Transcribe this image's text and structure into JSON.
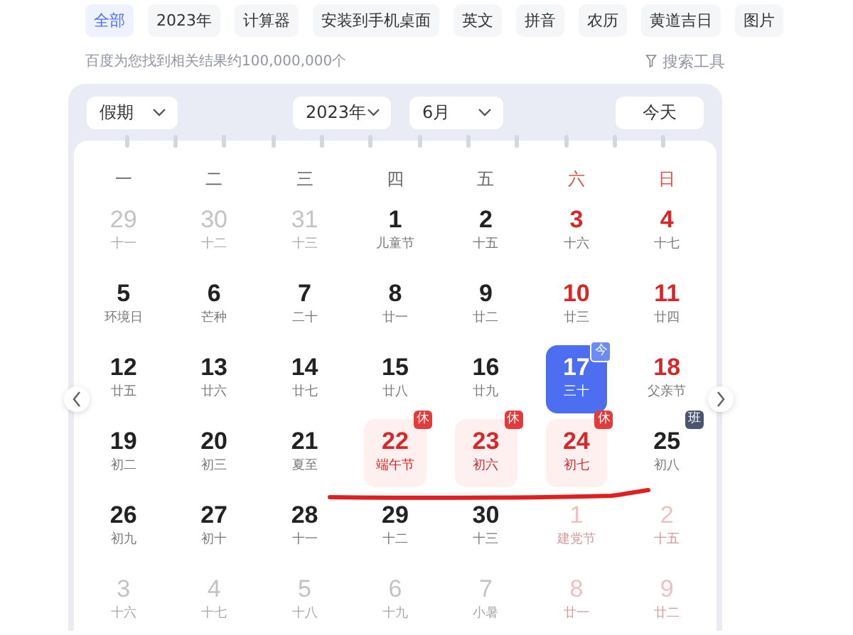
{
  "tabs": [
    {
      "label": "全部",
      "selected": true
    },
    {
      "label": "2023年",
      "selected": false
    },
    {
      "label": "计算器",
      "selected": false
    },
    {
      "label": "安装到手机桌面",
      "selected": false
    },
    {
      "label": "英文",
      "selected": false
    },
    {
      "label": "拼音",
      "selected": false
    },
    {
      "label": "农历",
      "selected": false
    },
    {
      "label": "黄道吉日",
      "selected": false
    },
    {
      "label": "图片",
      "selected": false
    }
  ],
  "result_count": "百度为您找到相关结果约100,000,000个",
  "search_tools": "搜索工具",
  "calendar": {
    "holiday_select": "假期",
    "year_select": "2023年",
    "month_select": "6月",
    "today_button": "今天",
    "weekdays": [
      {
        "label": "一",
        "weekend": false
      },
      {
        "label": "二",
        "weekend": false
      },
      {
        "label": "三",
        "weekend": false
      },
      {
        "label": "四",
        "weekend": false
      },
      {
        "label": "五",
        "weekend": false
      },
      {
        "label": "六",
        "weekend": true
      },
      {
        "label": "日",
        "weekend": true
      }
    ],
    "days": [
      {
        "day": "29",
        "lunar": "十一",
        "in_month": false,
        "weekend": false,
        "holiday": false,
        "selected": false
      },
      {
        "day": "30",
        "lunar": "十二",
        "in_month": false,
        "weekend": false,
        "holiday": false,
        "selected": false
      },
      {
        "day": "31",
        "lunar": "十三",
        "in_month": false,
        "weekend": false,
        "holiday": false,
        "selected": false
      },
      {
        "day": "1",
        "lunar": "儿童节",
        "in_month": true,
        "weekend": false,
        "holiday": false,
        "selected": false
      },
      {
        "day": "2",
        "lunar": "十五",
        "in_month": true,
        "weekend": false,
        "holiday": false,
        "selected": false
      },
      {
        "day": "3",
        "lunar": "十六",
        "in_month": true,
        "weekend": true,
        "holiday": false,
        "selected": false
      },
      {
        "day": "4",
        "lunar": "十七",
        "in_month": true,
        "weekend": true,
        "holiday": false,
        "selected": false
      },
      {
        "day": "5",
        "lunar": "环境日",
        "in_month": true,
        "weekend": false,
        "holiday": false,
        "selected": false
      },
      {
        "day": "6",
        "lunar": "芒种",
        "in_month": true,
        "weekend": false,
        "holiday": false,
        "selected": false
      },
      {
        "day": "7",
        "lunar": "二十",
        "in_month": true,
        "weekend": false,
        "holiday": false,
        "selected": false
      },
      {
        "day": "8",
        "lunar": "廿一",
        "in_month": true,
        "weekend": false,
        "holiday": false,
        "selected": false
      },
      {
        "day": "9",
        "lunar": "廿二",
        "in_month": true,
        "weekend": false,
        "holiday": false,
        "selected": false
      },
      {
        "day": "10",
        "lunar": "廿三",
        "in_month": true,
        "weekend": true,
        "holiday": false,
        "selected": false
      },
      {
        "day": "11",
        "lunar": "廿四",
        "in_month": true,
        "weekend": true,
        "holiday": false,
        "selected": false
      },
      {
        "day": "12",
        "lunar": "廿五",
        "in_month": true,
        "weekend": false,
        "holiday": false,
        "selected": false
      },
      {
        "day": "13",
        "lunar": "廿六",
        "in_month": true,
        "weekend": false,
        "holiday": false,
        "selected": false
      },
      {
        "day": "14",
        "lunar": "廿七",
        "in_month": true,
        "weekend": false,
        "holiday": false,
        "selected": false
      },
      {
        "day": "15",
        "lunar": "廿八",
        "in_month": true,
        "weekend": false,
        "holiday": false,
        "selected": false
      },
      {
        "day": "16",
        "lunar": "廿九",
        "in_month": true,
        "weekend": false,
        "holiday": false,
        "selected": false
      },
      {
        "day": "17",
        "lunar": "三十",
        "in_month": true,
        "weekend": true,
        "holiday": false,
        "selected": true,
        "badge": {
          "kind": "today",
          "text": "今"
        }
      },
      {
        "day": "18",
        "lunar": "父亲节",
        "in_month": true,
        "weekend": true,
        "holiday": false,
        "selected": false
      },
      {
        "day": "19",
        "lunar": "初二",
        "in_month": true,
        "weekend": false,
        "holiday": false,
        "selected": false
      },
      {
        "day": "20",
        "lunar": "初三",
        "in_month": true,
        "weekend": false,
        "holiday": false,
        "selected": false
      },
      {
        "day": "21",
        "lunar": "夏至",
        "in_month": true,
        "weekend": false,
        "holiday": false,
        "selected": false
      },
      {
        "day": "22",
        "lunar": "端午节",
        "in_month": true,
        "weekend": false,
        "holiday": true,
        "selected": false,
        "badge": {
          "kind": "rest",
          "text": "休"
        }
      },
      {
        "day": "23",
        "lunar": "初六",
        "in_month": true,
        "weekend": false,
        "holiday": true,
        "selected": false,
        "badge": {
          "kind": "rest",
          "text": "休"
        }
      },
      {
        "day": "24",
        "lunar": "初七",
        "in_month": true,
        "weekend": true,
        "holiday": true,
        "selected": false,
        "badge": {
          "kind": "rest",
          "text": "休"
        }
      },
      {
        "day": "25",
        "lunar": "初八",
        "in_month": true,
        "weekend": false,
        "holiday": false,
        "selected": false,
        "badge": {
          "kind": "work",
          "text": "班"
        }
      },
      {
        "day": "26",
        "lunar": "初九",
        "in_month": true,
        "weekend": false,
        "holiday": false,
        "selected": false
      },
      {
        "day": "27",
        "lunar": "初十",
        "in_month": true,
        "weekend": false,
        "holiday": false,
        "selected": false
      },
      {
        "day": "28",
        "lunar": "十一",
        "in_month": true,
        "weekend": false,
        "holiday": false,
        "selected": false
      },
      {
        "day": "29",
        "lunar": "十二",
        "in_month": true,
        "weekend": false,
        "holiday": false,
        "selected": false
      },
      {
        "day": "30",
        "lunar": "十三",
        "in_month": true,
        "weekend": false,
        "holiday": false,
        "selected": false
      },
      {
        "day": "1",
        "lunar": "建党节",
        "in_month": false,
        "weekend": true,
        "holiday": false,
        "selected": false
      },
      {
        "day": "2",
        "lunar": "十五",
        "in_month": false,
        "weekend": true,
        "holiday": false,
        "selected": false
      },
      {
        "day": "3",
        "lunar": "十六",
        "in_month": false,
        "weekend": false,
        "holiday": false,
        "selected": false
      },
      {
        "day": "4",
        "lunar": "十七",
        "in_month": false,
        "weekend": false,
        "holiday": false,
        "selected": false
      },
      {
        "day": "5",
        "lunar": "十八",
        "in_month": false,
        "weekend": false,
        "holiday": false,
        "selected": false
      },
      {
        "day": "6",
        "lunar": "十九",
        "in_month": false,
        "weekend": false,
        "holiday": false,
        "selected": false
      },
      {
        "day": "7",
        "lunar": "小暑",
        "in_month": false,
        "weekend": false,
        "holiday": false,
        "selected": false
      },
      {
        "day": "8",
        "lunar": "廿一",
        "in_month": false,
        "weekend": true,
        "holiday": false,
        "selected": false
      },
      {
        "day": "9",
        "lunar": "廿二",
        "in_month": false,
        "weekend": true,
        "holiday": false,
        "selected": false
      }
    ]
  }
}
